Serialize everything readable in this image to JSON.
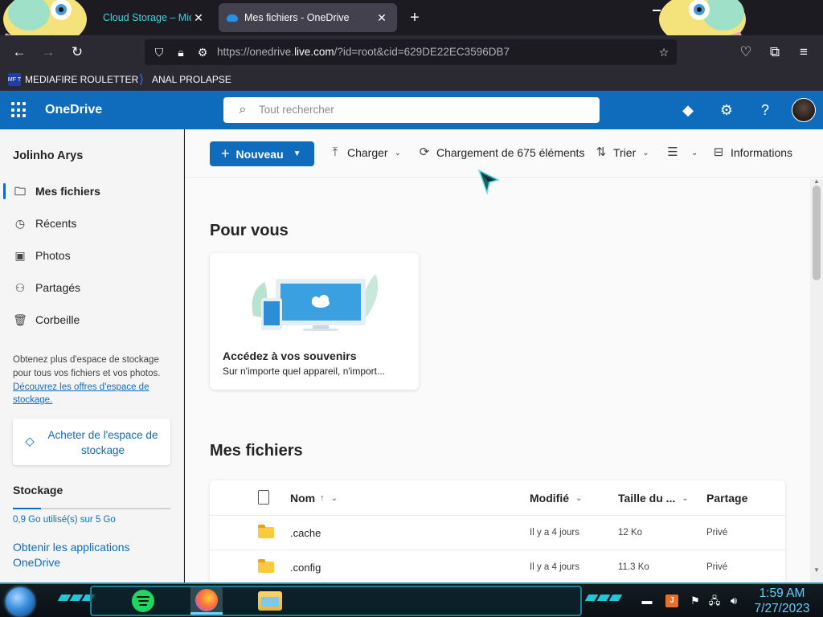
{
  "browser": {
    "tabs": [
      {
        "title": "Cloud Storage – Micro",
        "close": "✕",
        "active": false
      },
      {
        "title": "Mes fichiers - OneDrive",
        "close": "✕",
        "active": true
      }
    ],
    "new_tab": "+",
    "url_prefix": "https://onedrive.",
    "url_domain": "live.com",
    "url_suffix": "/?id=root&cid=629DE22EC3596DB7",
    "bookmarks": [
      {
        "icon_text": "MF T",
        "label": "MEDIAFIRE ROULETTER"
      },
      {
        "icon_text": "⟩",
        "label": "ANAL PROLAPSE"
      }
    ]
  },
  "onedrive": {
    "brand": "OneDrive",
    "search_placeholder": "Tout rechercher",
    "user_name": "Jolinho Arys",
    "nav": [
      {
        "label": "Mes fichiers",
        "icon": "folder-icon",
        "active": true
      },
      {
        "label": "Récents",
        "icon": "clock-icon",
        "active": false
      },
      {
        "label": "Photos",
        "icon": "photo-icon",
        "active": false
      },
      {
        "label": "Partagés",
        "icon": "people-icon",
        "active": false
      },
      {
        "label": "Corbeille",
        "icon": "trash-icon",
        "active": false
      }
    ],
    "promo_text": "Obtenez plus d'espace de stockage pour tous vos fichiers et vos photos.",
    "promo_link": "Découvrez les offres d'espace de stockage.",
    "buy_label": "Acheter de l'espace de stockage",
    "storage_title": "Stockage",
    "storage_used": "0,9 Go utilisé(s) sur 5 Go",
    "storage_fraction": 0.18,
    "apps_link": "Obtenir les applications OneDrive",
    "commands": {
      "new": "Nouveau",
      "upload": "Charger",
      "loading": "Chargement de 675 éléments",
      "sort": "Trier",
      "info": "Informations"
    },
    "for_you_title": "Pour vous",
    "card": {
      "title": "Accédez à vos souvenirs",
      "subtitle": "Sur n'importe quel appareil, n'import..."
    },
    "files_title": "Mes fichiers",
    "columns": {
      "name": "Nom",
      "name_sort": "↑",
      "modified": "Modifié",
      "size": "Taille du ...",
      "sharing": "Partage"
    },
    "files": [
      {
        "name": ".cache",
        "modified": "Il y a 4 jours",
        "size": "12 Ko",
        "sharing": "Privé"
      },
      {
        "name": ".config",
        "modified": "Il y a 4 jours",
        "size": "11.3 Ko",
        "sharing": "Privé"
      }
    ],
    "accent_color": "#0f6cbd"
  },
  "taskbar": {
    "time": "1:59 AM",
    "date": "7/27/2023",
    "java_icon": "J"
  }
}
